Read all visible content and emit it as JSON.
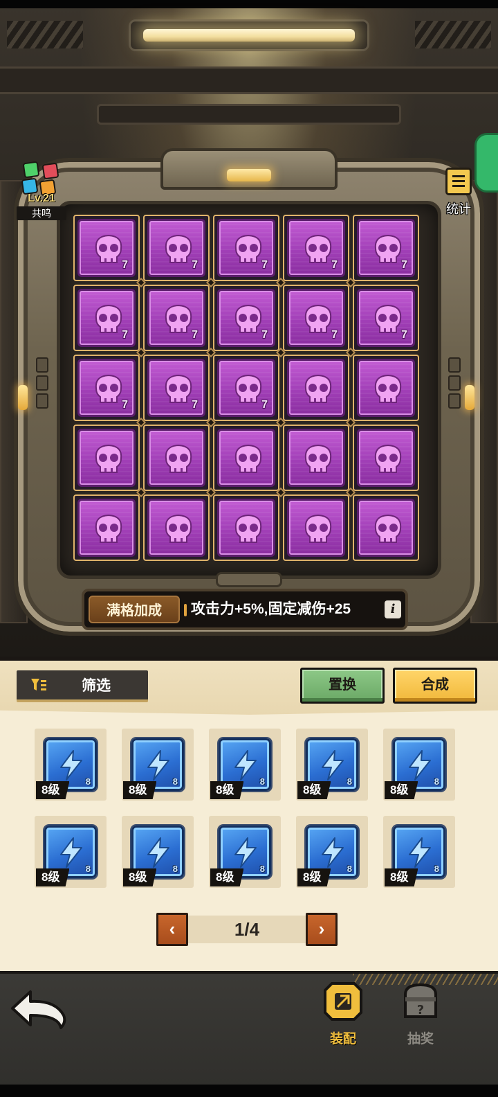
{
  "resonance": {
    "level": "Lv.21",
    "label": "共鸣"
  },
  "stats": {
    "label": "统计",
    "icon": "stats-list-icon"
  },
  "grid": {
    "rows": [
      [
        {
          "level": "7"
        },
        {
          "level": "7"
        },
        {
          "level": "7"
        },
        {
          "level": "7"
        },
        {
          "level": "7"
        }
      ],
      [
        {
          "level": "7"
        },
        {
          "level": "7"
        },
        {
          "level": "7"
        },
        {
          "level": "7"
        },
        {
          "level": "7"
        }
      ],
      [
        {
          "level": "7"
        },
        {
          "level": "7"
        },
        {
          "level": "7"
        },
        {
          "level": ""
        },
        {
          "level": ""
        }
      ],
      [
        {
          "level": ""
        },
        {
          "level": ""
        },
        {
          "level": ""
        },
        {
          "level": ""
        },
        {
          "level": ""
        }
      ],
      [
        {
          "level": ""
        },
        {
          "level": ""
        },
        {
          "level": ""
        },
        {
          "level": ""
        },
        {
          "level": ""
        }
      ]
    ],
    "cell_icon": "skull-icon"
  },
  "bonus": {
    "tag": "满格加成",
    "text": "攻击力+5%,固定减伤+25",
    "info": "i"
  },
  "panel": {
    "filter_label": "筛选",
    "swap_label": "置换",
    "merge_label": "合成"
  },
  "inventory": {
    "items": [
      {
        "tag": "8级",
        "mini": "8"
      },
      {
        "tag": "8级",
        "mini": "8"
      },
      {
        "tag": "8级",
        "mini": "8"
      },
      {
        "tag": "8级",
        "mini": "8"
      },
      {
        "tag": "8级",
        "mini": "8"
      },
      {
        "tag": "8级",
        "mini": "8"
      },
      {
        "tag": "8级",
        "mini": "8"
      },
      {
        "tag": "8级",
        "mini": "8"
      },
      {
        "tag": "8级",
        "mini": "8"
      },
      {
        "tag": "8级",
        "mini": "8"
      }
    ],
    "item_icon": "lightning-icon"
  },
  "pager": {
    "label": "1/4",
    "prev": "‹",
    "next": "›"
  },
  "nav": {
    "equip_label": "装配",
    "draw_label": "抽奖"
  },
  "colors": {
    "accent": "#f0be3d",
    "cell_purple": "#a13fb7",
    "item_blue": "#2b6ed2"
  }
}
